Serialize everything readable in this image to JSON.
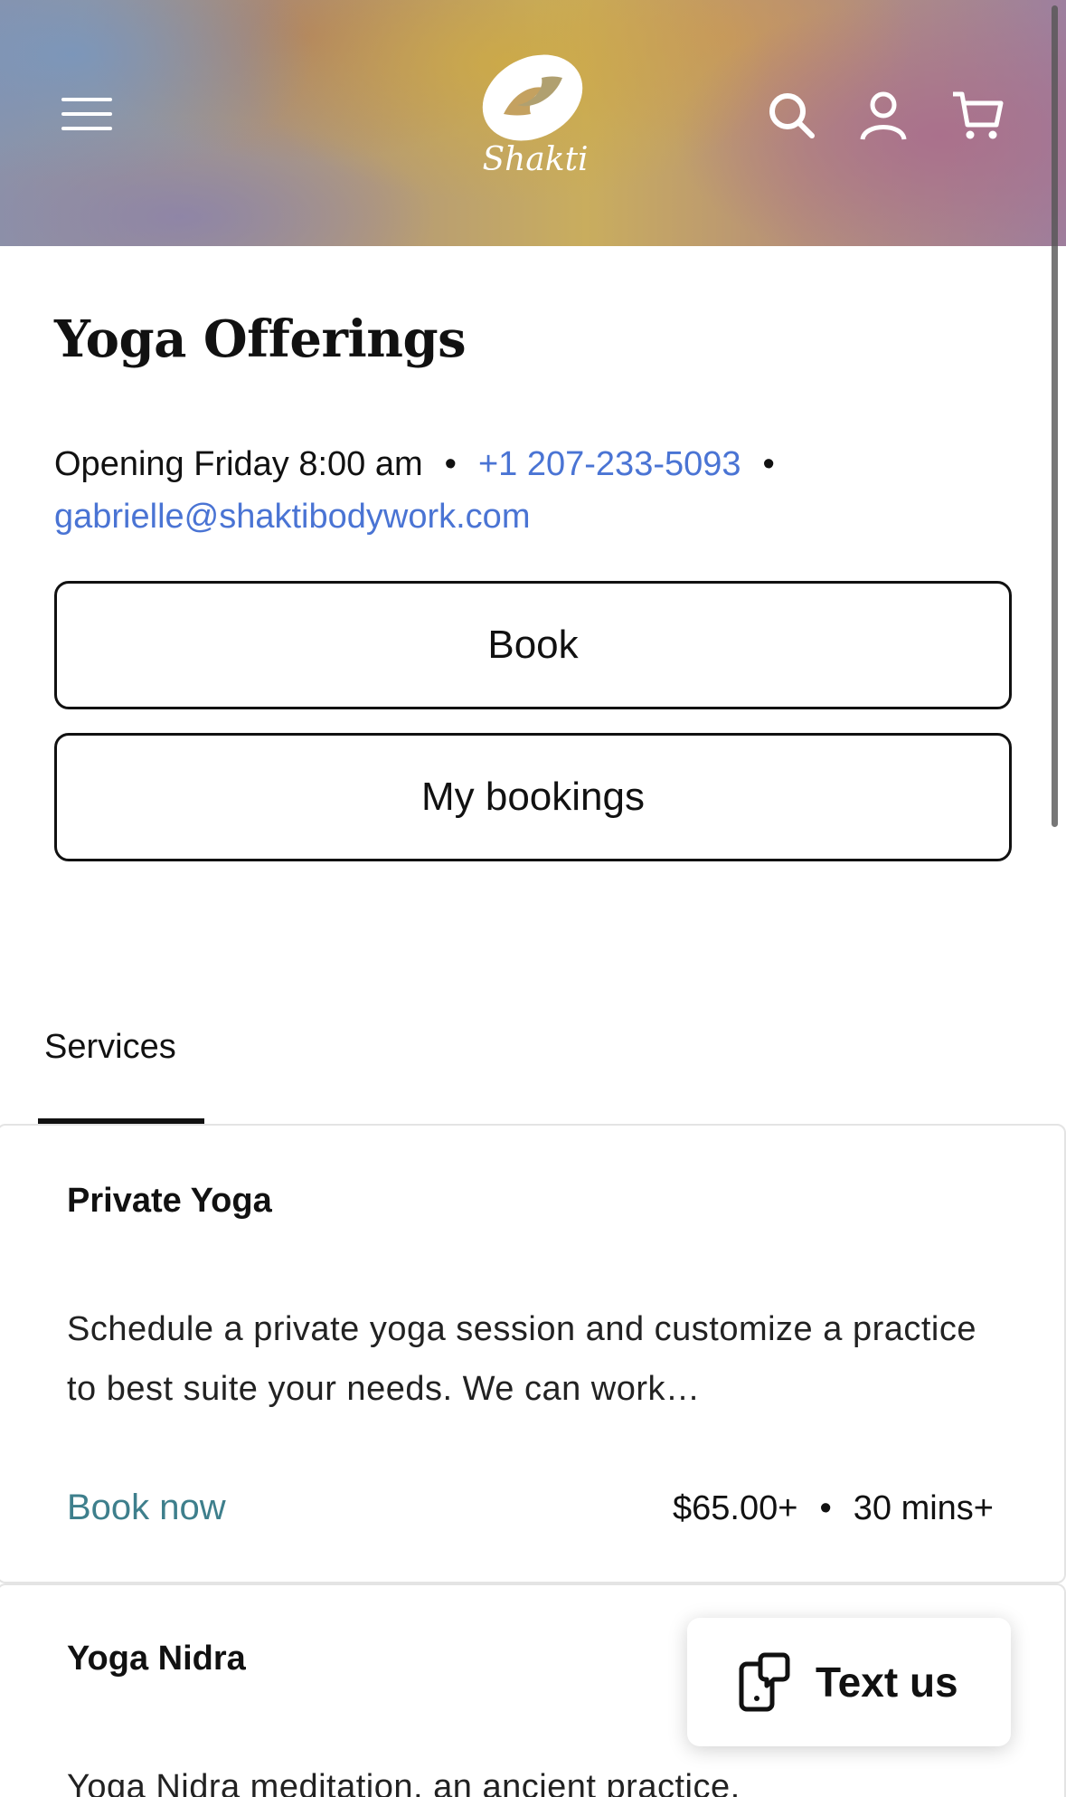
{
  "header": {
    "logo_text": "Shakti",
    "menu_icon": "hamburger-menu-icon",
    "search_icon": "search-icon",
    "account_icon": "account-icon",
    "cart_icon": "cart-icon"
  },
  "page": {
    "title": "Yoga Offerings",
    "opening": "Opening Friday 8:00 am",
    "phone": "+1 207-233-5093",
    "email": "gabrielle@shaktibodywork.com",
    "separator": "•",
    "book_button": "Book",
    "my_bookings_button": "My bookings"
  },
  "tabs": [
    {
      "label": "Services",
      "active": true
    }
  ],
  "services": [
    {
      "title": "Private Yoga",
      "description": "Schedule a private yoga session and customize a practice to best suite your needs. We can work…",
      "book_label": "Book now",
      "price": "$65.00+",
      "duration": "30 mins+"
    },
    {
      "title": "Yoga Nidra",
      "description": "Yoga Nidra meditation, an ancient practice,"
    }
  ],
  "chat_widget": {
    "label": "Text us",
    "icon": "chat-phone-icon"
  },
  "colors": {
    "link": "#4a74d4",
    "book_now": "#3e7f8c",
    "text": "#111111"
  }
}
